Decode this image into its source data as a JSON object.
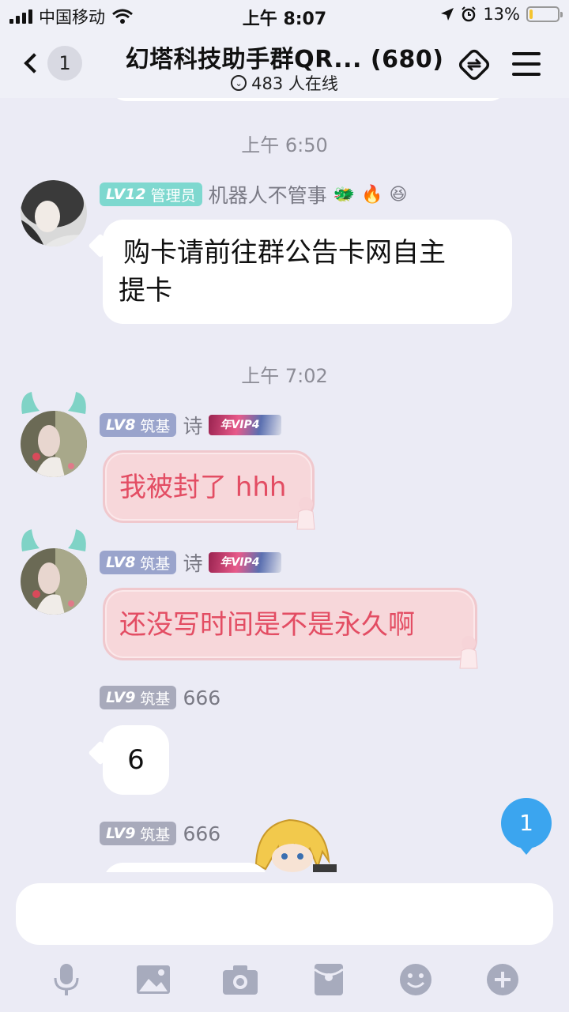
{
  "status_bar": {
    "carrier": "中国移动",
    "time": "上午 8:07",
    "battery_percent_text": "13%",
    "battery_level": 0.13
  },
  "header": {
    "back_badge": "1",
    "title": "幻塔科技助手群QR... (680)",
    "online_text": "483 人在线"
  },
  "messages": [
    {
      "timestamp": "上午 6:50",
      "level": "LV12",
      "rank": "管理员",
      "sender": "机器人不管事",
      "text_line1": "购卡请前往群公告卡网自主",
      "text_line2": "提卡"
    },
    {
      "timestamp": "上午 7:02",
      "level": "LV8",
      "rank": "筑基",
      "sender": "诗",
      "vip": "年VIP4",
      "text": "我被封了 hhh"
    },
    {
      "level": "LV8",
      "rank": "筑基",
      "sender": "诗",
      "vip": "年VIP4",
      "text": "还没写时间是不是永久啊"
    },
    {
      "level": "LV9",
      "rank": "筑基",
      "sender": "666",
      "text": "6"
    },
    {
      "level": "LV9",
      "rank": "筑基",
      "sender": "666"
    }
  ],
  "floating_unread": "1",
  "input": {
    "placeholder": ""
  },
  "toolbar": {
    "icons": [
      "microphone-icon",
      "image-icon",
      "camera-icon",
      "red-packet-icon",
      "emoji-icon",
      "plus-icon"
    ]
  },
  "colors": {
    "background": "#ebebf5",
    "admin_badge": "#7ed8cf",
    "pink_bubble_text": "#e34d63",
    "unread_blue": "#3ba5ef"
  }
}
